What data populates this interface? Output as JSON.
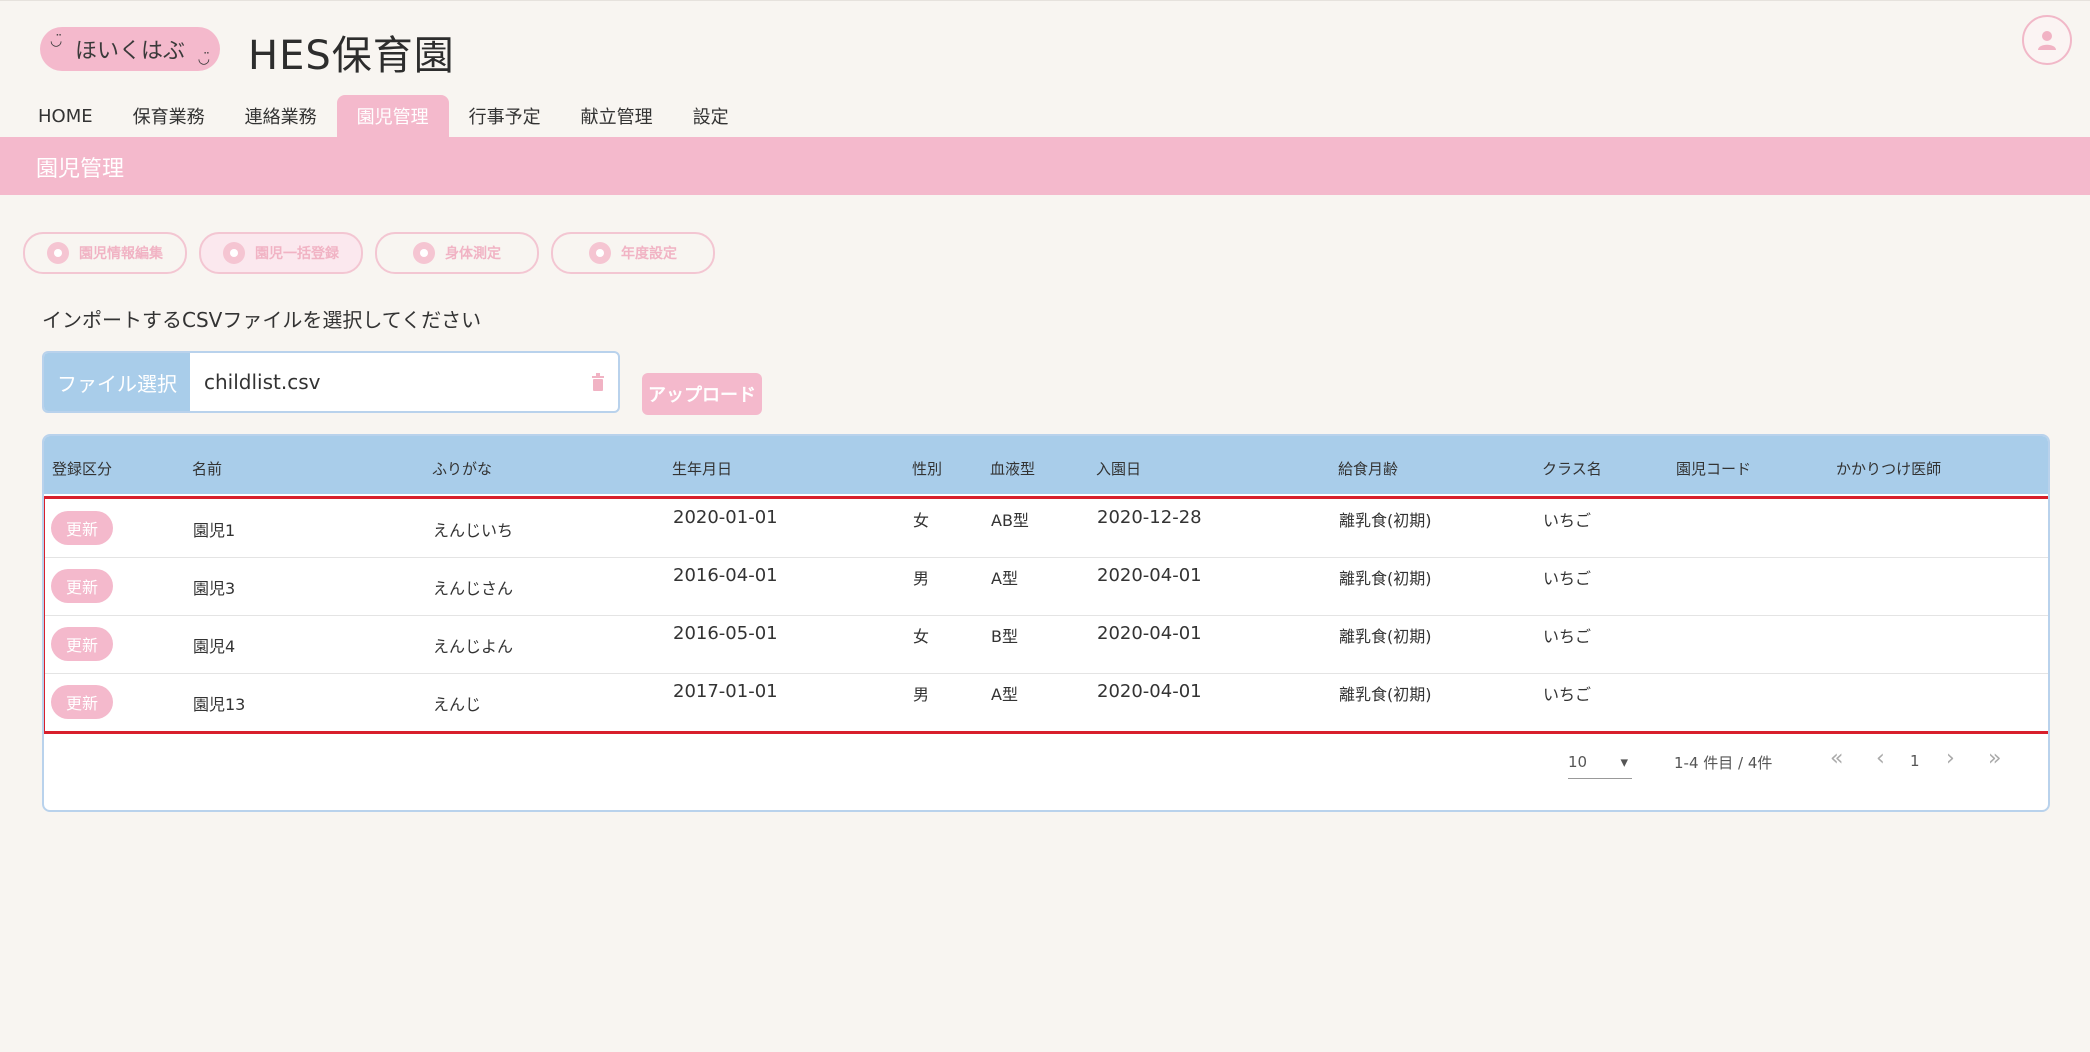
{
  "brand": {
    "logo_text": "ほいくはぶ",
    "face_left": "◡̈",
    "face_right": "◡̈",
    "app_title": "HES保育園"
  },
  "nav": {
    "tabs": [
      "HOME",
      "保育業務",
      "連絡業務",
      "園児管理",
      "行事予定",
      "献立管理",
      "設定"
    ],
    "active": "園児管理"
  },
  "page_title": "園児管理",
  "actions": [
    "園児情報編集",
    "園児一括登録",
    "身体測定",
    "年度設定"
  ],
  "instruction": "インポートするCSVファイルを選択してください",
  "file_picker": {
    "button_label": "ファイル選択",
    "file_name": "childlist.csv"
  },
  "upload_label": "アップロード",
  "table": {
    "columns": [
      "登録区分",
      "名前",
      "ふりがな",
      "生年月日",
      "性別",
      "血液型",
      "入園日",
      "給食月齢",
      "クラス名",
      "園児コード",
      "かかりつけ医師"
    ],
    "rows": [
      {
        "status": "更新",
        "name": "園児1",
        "kana": "えんじいち",
        "birth": "2020-01-01",
        "sex": "女",
        "blood": "AB型",
        "admission": "2020-12-28",
        "meal": "離乳食(初期)",
        "class": "いちご",
        "code": "",
        "doctor": ""
      },
      {
        "status": "更新",
        "name": "園児3",
        "kana": "えんじさん",
        "birth": "2016-04-01",
        "sex": "男",
        "blood": "A型",
        "admission": "2020-04-01",
        "meal": "離乳食(初期)",
        "class": "いちご",
        "code": "",
        "doctor": ""
      },
      {
        "status": "更新",
        "name": "園児4",
        "kana": "えんじよん",
        "birth": "2016-05-01",
        "sex": "女",
        "blood": "B型",
        "admission": "2020-04-01",
        "meal": "離乳食(初期)",
        "class": "いちご",
        "code": "",
        "doctor": ""
      },
      {
        "status": "更新",
        "name": "園児13",
        "kana": "えんじ",
        "birth": "2017-01-01",
        "sex": "男",
        "blood": "A型",
        "admission": "2020-04-01",
        "meal": "離乳食(初期)",
        "class": "いちご",
        "code": "",
        "doctor": ""
      }
    ]
  },
  "pagination": {
    "per_page": "10",
    "range": "1-4 件目 / 4件",
    "page": "1"
  },
  "colors": {
    "pink": "#f4b9cc",
    "blue": "#a9cdea",
    "highlight": "#d81f2c"
  }
}
